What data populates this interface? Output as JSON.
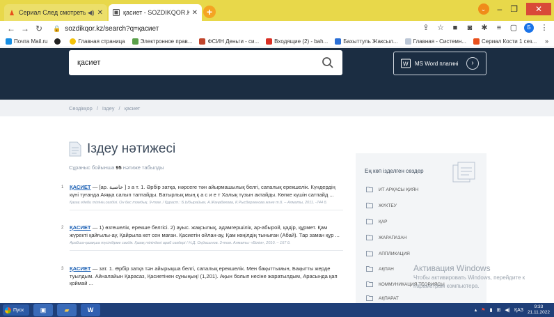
{
  "browser": {
    "tabs": [
      {
        "title": "Сериал След смотреть онл",
        "active": false
      },
      {
        "title": "қасиет - SOZDIKQOR.KZ",
        "active": true
      }
    ],
    "address": "sozdikqor.kz/search?q=қасиет",
    "profile_letter": "Б",
    "bookmarks": [
      "Почта Mail.ru",
      "",
      "Главная страница",
      "Электронное прав...",
      "ФСИН Деньги - си...",
      "Входящие (2) - bah...",
      "Бахыттуль Жаксыл...",
      "Главная - Системн...",
      "Сериал Кости 1 сез..."
    ],
    "bookmarks_more": "»"
  },
  "header": {
    "search_value": "қасиет",
    "msword_label": "MS Word плагині"
  },
  "breadcrumb": [
    "Сөздікқор",
    "/",
    "Іздеу",
    "/",
    "қасиет"
  ],
  "results": {
    "title": "Іздеу нәтижесі",
    "count_prefix": "Сұраныс бойынша",
    "count": "95",
    "count_suffix": "нәтиже табылды",
    "items": [
      {
        "num": "1",
        "head": "ҚАСИЕТ",
        "text": " — [ар. خاصية ] з а т. 1. Әрбір затқа, нәрсеге тән айырмашылық белгі, сапалық ерекшелік. Күндердің күні туғанда Аяққа салып таптайды. Батырлық мың қ а с и е т Халық түзын актайды. Көпке күшін сатпайд ...",
        "source": "Қазақ әдеби тілінің сөздігі. Он бес томдық. 9-том. / Құраст.: Б.Ыбырайым, А.Жаңабекова, К.Рысбергенова және т.б. – Алматы, 2011. -744 б."
      },
      {
        "num": "2",
        "head": "ҚАСИЕТ",
        "text": " — 1) өзгешелік, ерекше белгісі. 2) ауыс. жақсылық, адамгершілік, ар-абырой, қадір, құрмет. Қам жүректі қайғылы-ау, Қайрыла кет сен маған. Қасиетін ойлан-ау, Қам көңілдің тыныған (Абай). Тар заман құр ...",
        "source": "Арабша-қазақша түсіндірме сөздік. Қазақ тіліндегі араб сөздері / Н.Д. Оңдасынов. 3-том. Алматы: «Білім», 2010. – 167 б."
      },
      {
        "num": "3",
        "head": "ҚАСИЕТ",
        "text": " — зат. 1. Әрбір затқа тән айырықша белгі, сапалық ерекшелік. Мен бақыттымын, Бақытты жерде туылдым. Айналайын Қарасаз, Қасиетінен сұныңың! (1,201). Ақын болып несіне жаратылдым, Арасында қап қоймай ...",
        "source": ""
      }
    ]
  },
  "sidebar": {
    "heading": "Ең көп ізделген сөздер",
    "items": [
      "ит арқасы қиян",
      "жүктеу",
      "қар",
      "жарапазан",
      "аппликация",
      "ақпан",
      "коммуникация теориясы",
      "ақпарат"
    ]
  },
  "watermark": {
    "line1": "Активация Windows",
    "line2": "Чтобы активировать Windows, перейдите к",
    "line3": "параметрам компьютера."
  },
  "taskbar": {
    "start_label": "Пуск",
    "lang": "ҚАЗ",
    "time": "9:33",
    "date": "21.11.2022"
  }
}
